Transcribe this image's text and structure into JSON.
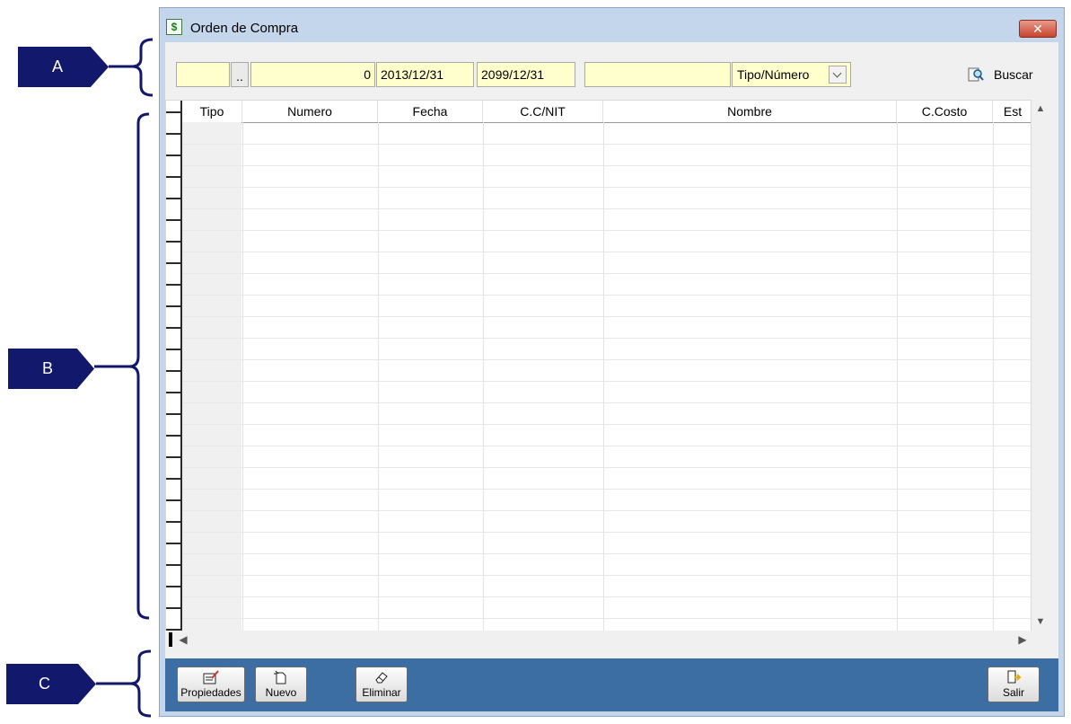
{
  "callouts": [
    "A",
    "B",
    "C"
  ],
  "window": {
    "title": "Orden de Compra",
    "close_label": "✕"
  },
  "filters": {
    "code_value": "",
    "browse_label": "..",
    "number_value": "0",
    "date_from": "2013/12/31",
    "date_to": "2099/12/31",
    "search_text": "",
    "order_select": "Tipo/Número",
    "search_button": "Buscar"
  },
  "grid": {
    "columns": [
      "Tipo",
      "Numero",
      "Fecha",
      "C.C/NIT",
      "Nombre",
      "C.Costo",
      "Est"
    ],
    "rows": []
  },
  "toolbar": {
    "propiedades": "Propiedades",
    "nuevo": "Nuevo",
    "eliminar": "Eliminar",
    "salir": "Salir"
  },
  "colors": {
    "field_bg": "#ffffcd",
    "toolbar_bg": "#3c6ea4",
    "callout_bg": "#12186b",
    "window_frame": "#c4d6ec"
  }
}
